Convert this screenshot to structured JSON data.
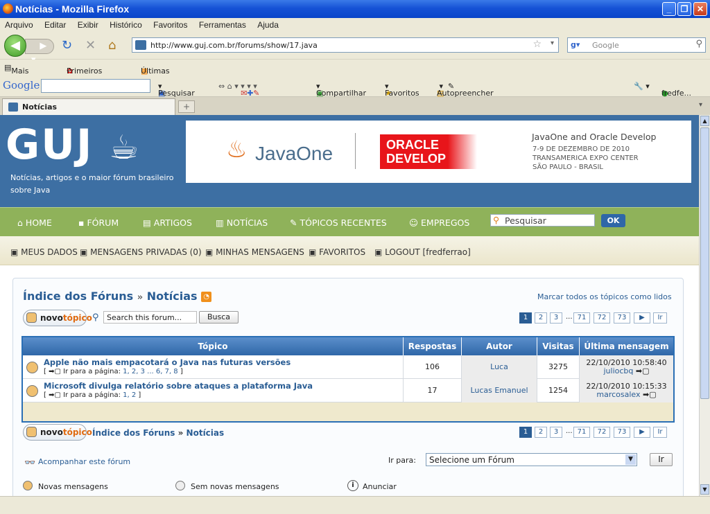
{
  "window": {
    "title": "Notícias - Mozilla Firefox"
  },
  "menu": [
    "Arquivo",
    "Editar",
    "Exibir",
    "Histórico",
    "Favoritos",
    "Ferramentas",
    "Ajuda"
  ],
  "nav": {
    "url": "http://www.guj.com.br/forums/show/17.java",
    "search_placeholder": "Google"
  },
  "bookmarks": [
    "Mais visitados",
    "Primeiros passos",
    "Últimas notícias"
  ],
  "google_toolbar": {
    "logo": "Google",
    "items": [
      "Pesquisar",
      "Compartilhar",
      "Favoritos",
      "Autopreencher",
      "fredfe..."
    ]
  },
  "tab": {
    "label": "Notícias"
  },
  "site": {
    "logo": "GUJ",
    "tagline": "Notícias, artigos e o maior fórum brasileiro sobre Java",
    "banner": {
      "brand": "JavaOne",
      "oracle_1": "ORACLE",
      "oracle_2": "DEVELOP",
      "title": "JavaOne and Oracle Develop",
      "line1": "7-9 DE DEZEMBRO DE 2010",
      "line2": "TRANSAMERICA EXPO CENTER",
      "line3": "SÃO PAULO - BRASIL"
    },
    "main_nav": [
      "HOME",
      "FÓRUM",
      "ARTIGOS",
      "NOTÍCIAS",
      "TÓPICOS RECENTES",
      "EMPREGOS"
    ],
    "search_placeholder": "Pesquisar",
    "search_button": "OK",
    "user_nav": [
      "MEUS DADOS",
      "MENSAGENS PRIVADAS (0)",
      "MINHAS MENSAGENS",
      "FAVORITOS",
      "LOGOUT [fredferrao]"
    ]
  },
  "forum": {
    "crumb_root": "Índice dos Fóruns",
    "crumb_sep": "»",
    "crumb_current": "Notícias",
    "mark_read": "Marcar todos os tópicos como lidos",
    "new_topic_a": "novo",
    "new_topic_b": "tópico",
    "search_placeholder": "Search this forum...",
    "search_button": "Busca",
    "pages": [
      "1",
      "2",
      "3",
      "...",
      "71",
      "72",
      "73",
      "▶",
      "Ir"
    ],
    "columns": [
      "Tópico",
      "Respostas",
      "Autor",
      "Visitas",
      "Última mensagem"
    ],
    "rows": [
      {
        "title": "Apple não mais empacotará o Java nas futuras versões",
        "pages_prefix": "[ ",
        "pages_label": " Ir para a página: ",
        "pages_links": "1, 2, 3  ...  6, 7, 8",
        "pages_suffix": " ]",
        "replies": "106",
        "author": "Luca",
        "views": "3275",
        "last_date": "22/10/2010 10:58:40",
        "last_user": "juliocbq"
      },
      {
        "title": "Microsoft divulga relatório sobre ataques a plataforma Java",
        "pages_prefix": "[ ",
        "pages_label": " Ir para a página: ",
        "pages_links": "1, 2",
        "pages_suffix": " ]",
        "replies": "17",
        "author": "Lucas Emanuel",
        "views": "1254",
        "last_date": "22/10/2010 10:15:33",
        "last_user": "marcosalex"
      }
    ],
    "follow": "Acompanhar este fórum",
    "goto_label": "Ir para:",
    "goto_select": "Selecione um Fórum",
    "goto_button": "Ir",
    "legend": [
      "Novas mensagens",
      "Sem novas mensagens",
      "Anunciar"
    ]
  }
}
